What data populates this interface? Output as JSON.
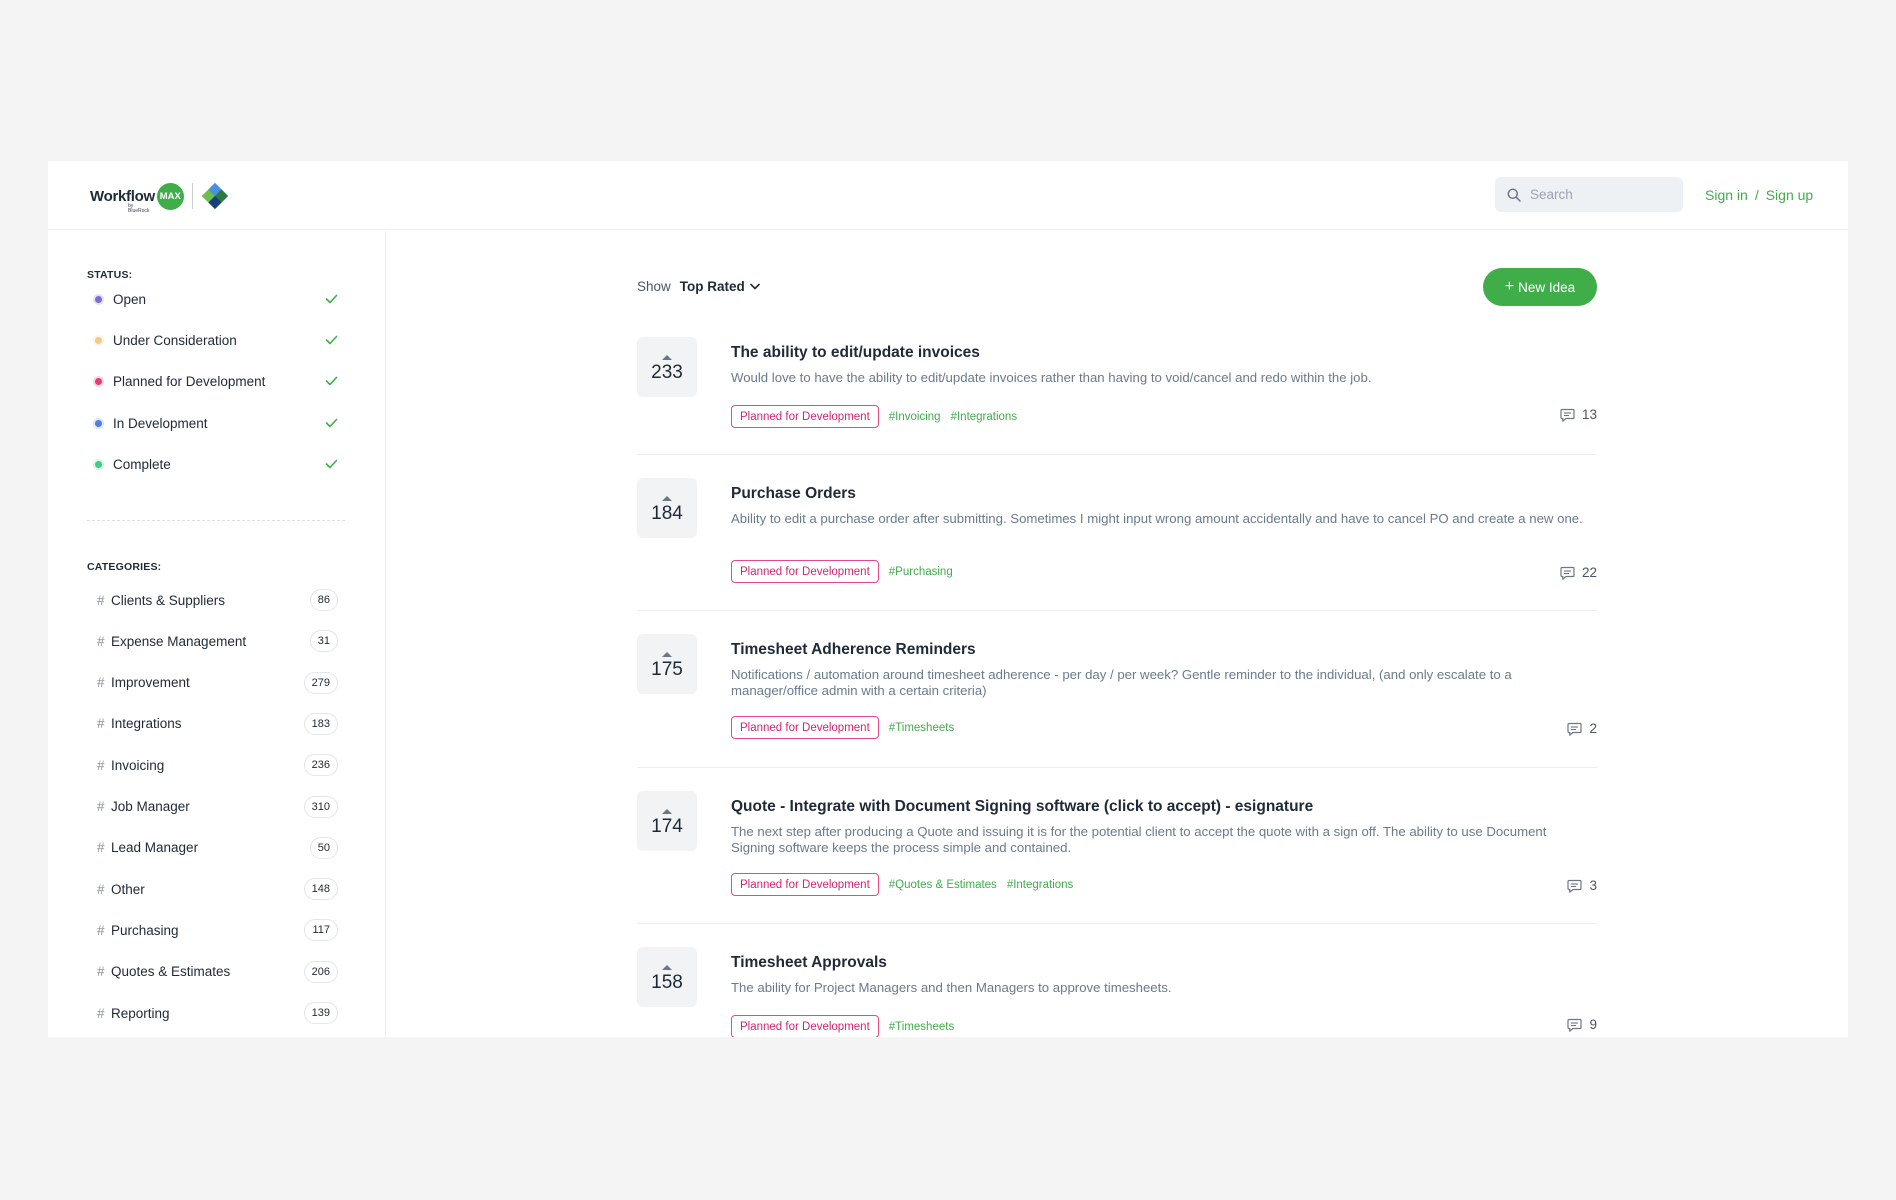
{
  "brand": {
    "name": "Workflow",
    "badge": "MAX",
    "byline": "by BlueRock"
  },
  "search": {
    "placeholder": "Search"
  },
  "auth": {
    "sign_in": "Sign in",
    "separator": "/",
    "sign_up": "Sign up"
  },
  "sidebar": {
    "status_heading": "STATUS:",
    "statuses": [
      {
        "label": "Open",
        "color": "#7b6bd9"
      },
      {
        "label": "Under Consideration",
        "color": "#f5c98b"
      },
      {
        "label": "Planned for Development",
        "color": "#e5397e"
      },
      {
        "label": "In Development",
        "color": "#4f7fe0"
      },
      {
        "label": "Complete",
        "color": "#3fce86"
      }
    ],
    "categories_heading": "CATEGORIES:",
    "categories": [
      {
        "label": "Clients & Suppliers",
        "count": "86"
      },
      {
        "label": "Expense Management",
        "count": "31"
      },
      {
        "label": "Improvement",
        "count": "279"
      },
      {
        "label": "Integrations",
        "count": "183"
      },
      {
        "label": "Invoicing",
        "count": "236"
      },
      {
        "label": "Job Manager",
        "count": "310"
      },
      {
        "label": "Lead Manager",
        "count": "50"
      },
      {
        "label": "Other",
        "count": "148"
      },
      {
        "label": "Purchasing",
        "count": "117"
      },
      {
        "label": "Quotes & Estimates",
        "count": "206"
      },
      {
        "label": "Reporting",
        "count": "139"
      }
    ]
  },
  "main": {
    "show_label": "Show",
    "sort_value": "Top Rated",
    "new_idea_label": "New Idea",
    "ideas": [
      {
        "votes": "233",
        "title": "The ability to edit/update invoices",
        "description": "Would love to have the ability to edit/update invoices rather than having to void/cancel and redo within the job.",
        "status": "Planned for Development",
        "tags": [
          "#Invoicing",
          "#Integrations"
        ],
        "comments": "13"
      },
      {
        "votes": "184",
        "title": "Purchase Orders",
        "description": "Ability to edit a purchase order after submitting. Sometimes I might input wrong amount accidentally and have to cancel PO and create a new one.",
        "status": "Planned for Development",
        "tags": [
          "#Purchasing"
        ],
        "comments": "22"
      },
      {
        "votes": "175",
        "title": "Timesheet Adherence Reminders",
        "description": "Notifications / automation around timesheet adherence - per day / per week? Gentle reminder to the individual, (and only escalate to a manager/office admin with a certain criteria)",
        "status": "Planned for Development",
        "tags": [
          "#Timesheets"
        ],
        "comments": "2"
      },
      {
        "votes": "174",
        "title": "Quote - Integrate with Document Signing software (click to accept) - esignature",
        "description": "The next step after producing a Quote and issuing it is for the potential client to accept the quote with a sign off. The ability to use Document Signing software keeps the process simple and contained.",
        "status": "Planned for Development",
        "tags": [
          "#Quotes & Estimates",
          "#Integrations"
        ],
        "comments": "3"
      },
      {
        "votes": "158",
        "title": "Timesheet Approvals",
        "description": "The ability for Project Managers and then Managers to approve timesheets.",
        "status": "Planned for Development",
        "tags": [
          "#Timesheets"
        ],
        "comments": "9"
      }
    ]
  }
}
